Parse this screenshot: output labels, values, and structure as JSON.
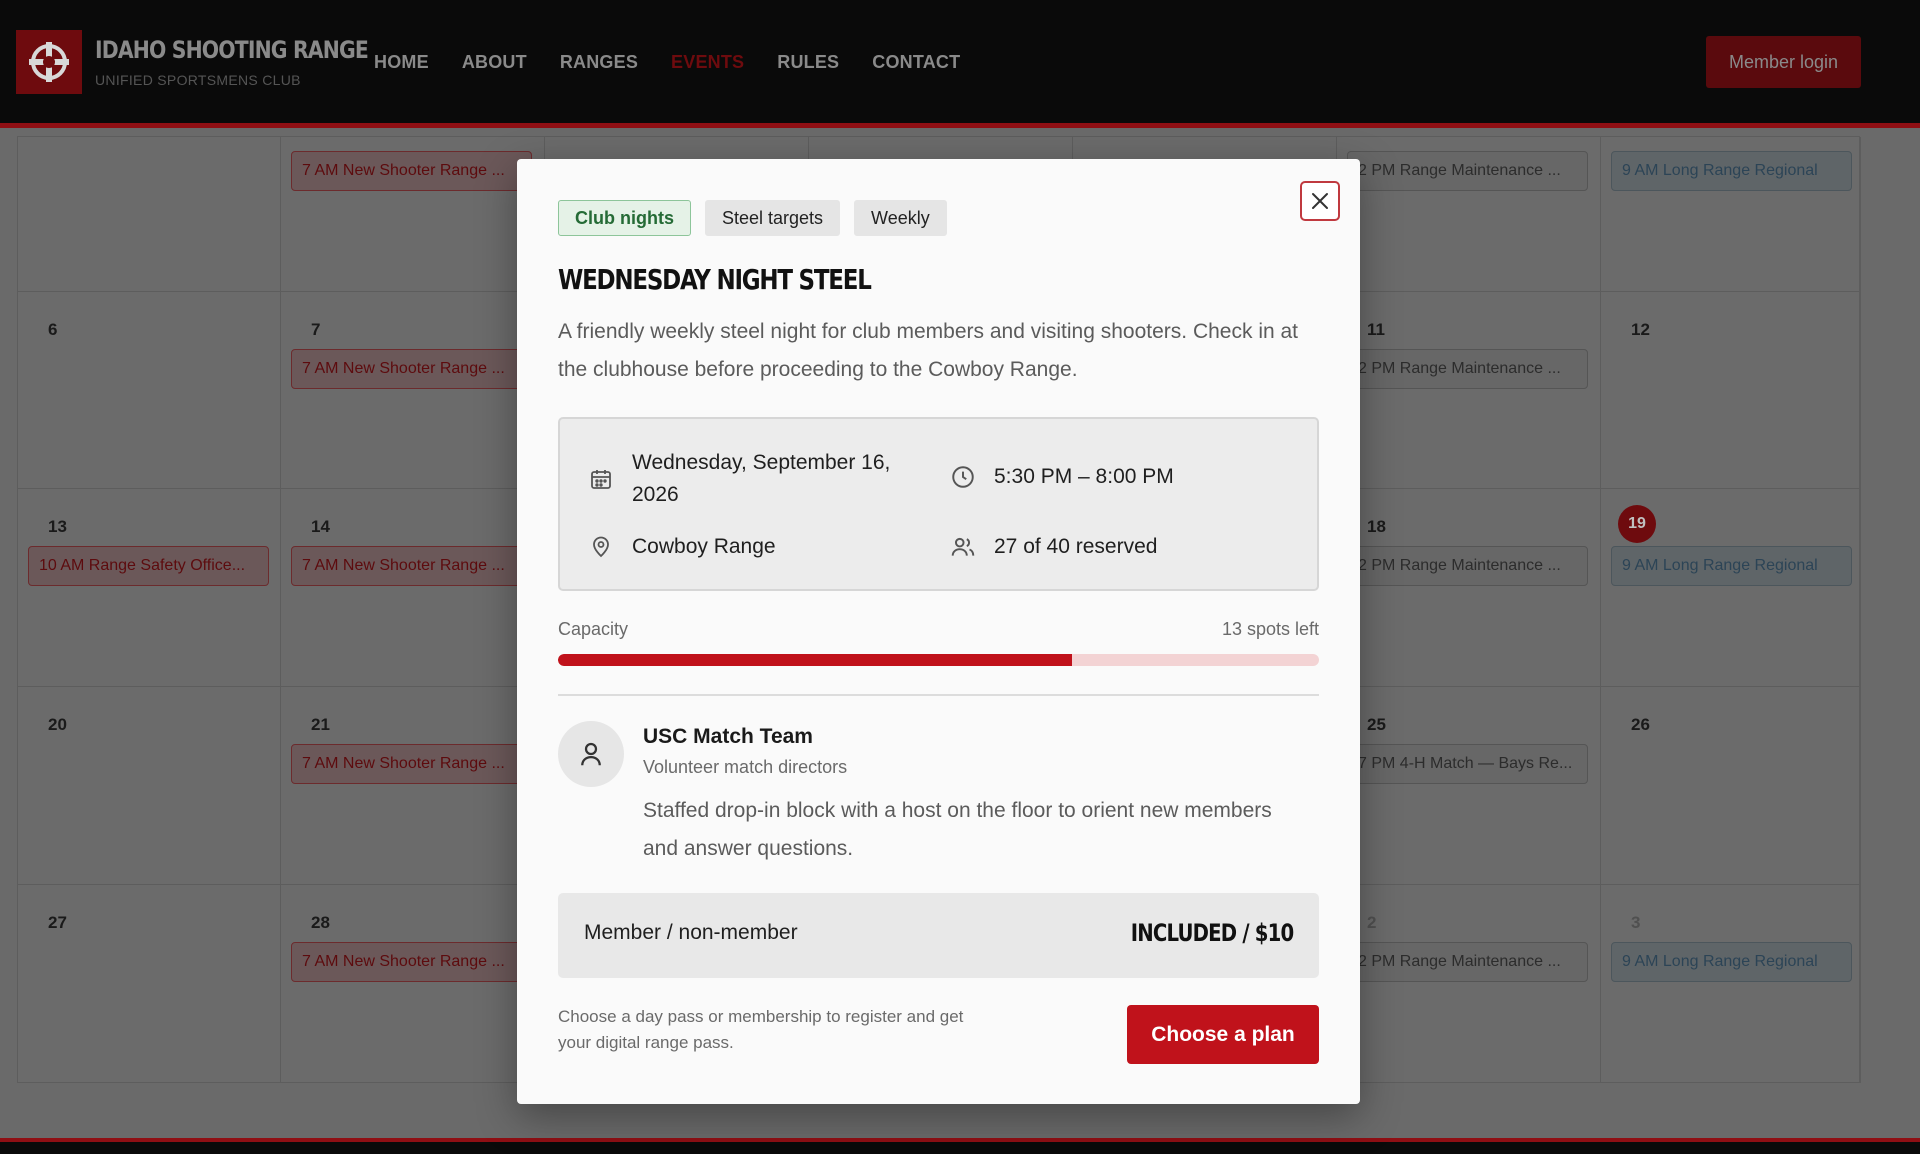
{
  "site": {
    "brand_title": "IDAHO SHOOTING RANGE",
    "brand_subtitle": "UNIFIED SPORTSMENS CLUB",
    "nav": [
      "HOME",
      "ABOUT",
      "RANGES",
      "EVENTS",
      "RULES",
      "CONTACT"
    ],
    "nav_active": "EVENTS",
    "member_login": "Member login"
  },
  "calendar": {
    "rows": [
      [
        "",
        "",
        "",
        "",
        "",
        "",
        ""
      ],
      [
        "6",
        "7",
        "",
        "",
        "",
        "11",
        "12"
      ],
      [
        "13",
        "14",
        "",
        "",
        "",
        "18",
        "19"
      ],
      [
        "20",
        "21",
        "",
        "",
        "",
        "25",
        "26"
      ],
      [
        "27",
        "28",
        "",
        "",
        "",
        "2",
        "3"
      ]
    ],
    "today": "19",
    "events": [
      {
        "text": "7 AM New Shooter Range ...",
        "style": "red"
      },
      {
        "text": "2 PM Range Maintenance ...",
        "style": "grey"
      },
      {
        "text": "9 AM Long Range Regional",
        "style": "blue"
      },
      {
        "text": "7 AM New Shooter Range ...",
        "style": "red"
      },
      {
        "text": "2 PM Range Maintenance ...",
        "style": "grey"
      },
      {
        "text": "10 AM Range Safety Office...",
        "style": "red"
      },
      {
        "text": "7 AM New Shooter Range ...",
        "style": "red"
      },
      {
        "text": "2 PM Range Maintenance ...",
        "style": "grey"
      },
      {
        "text": "9 AM Long Range Regional",
        "style": "blue"
      },
      {
        "text": "7 AM New Shooter Range ...",
        "style": "red"
      },
      {
        "text": "7 PM 4-H Match — Bays Re...",
        "style": "grey"
      },
      {
        "text": "7 AM New Shooter Range ...",
        "style": "red"
      },
      {
        "text": "2 PM Range Maintenance ...",
        "style": "grey"
      },
      {
        "text": "9 AM Long Range Regional",
        "style": "blue"
      }
    ]
  },
  "modal": {
    "tags": [
      "Club nights",
      "Steel targets",
      "Weekly"
    ],
    "title": "WEDNESDAY NIGHT STEEL",
    "description": "A friendly weekly steel night for club members and visiting shooters. Check in at the clubhouse before proceeding to the Cowboy Range.",
    "date": "Wednesday, September 16, 2026",
    "time": "5:30 PM – 8:00 PM",
    "location": "Cowboy Range",
    "reserved": "27 of 40 reserved",
    "capacity_label": "Capacity",
    "spots_left": "13 spots left",
    "capacity_fraction": 0.675,
    "host_name": "USC Match Team",
    "host_role": "Volunteer match directors",
    "host_description": "Staffed drop-in block with a host on the floor to orient new members and answer questions.",
    "price_label": "Member / non-member",
    "price_value": "INCLUDED / $10",
    "cta_note": "Choose a day pass or membership to register and get your digital range pass.",
    "cta_button": "Choose a plan"
  },
  "colors": {
    "accent": "#c0121b",
    "tag_green": "#256b36"
  },
  "icons": [
    "close-icon",
    "calendar-icon",
    "clock-icon",
    "map-pin-icon",
    "users-icon",
    "user-icon"
  ]
}
